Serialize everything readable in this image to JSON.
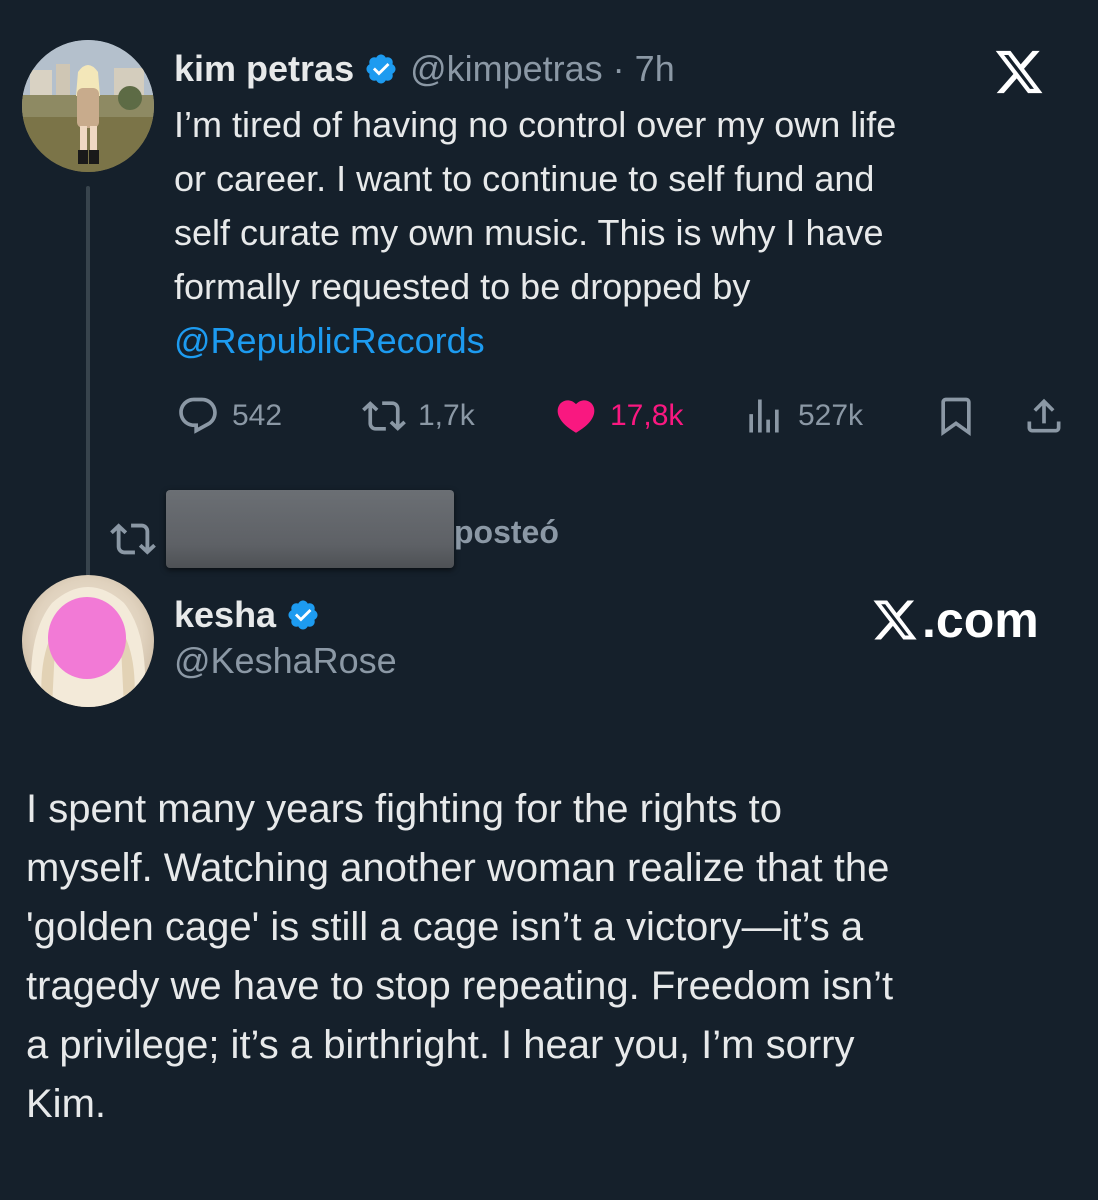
{
  "original_tweet": {
    "display_name": "kim petras",
    "meta": "@kimpetras · 7h",
    "text_lines": "I’m tired of having no control over my own life\nor career. I want to continue to self fund and\nself curate my own music. This is why I have\nformally requested to be dropped by",
    "mention": "@RepublicRecords",
    "actions": {
      "replies": "542",
      "reposts": "1,7k",
      "likes": "17,8k",
      "views": "527k"
    },
    "colors": {
      "like_active": "#f91880",
      "link": "#1d9bf0",
      "verified": "#1d9bf0"
    }
  },
  "repost_label": "posteó",
  "reply_tweet": {
    "display_name": "kesha",
    "handle": "@KeshaRose",
    "watermark": ".com",
    "text": "I spent many years fighting for the rights to\nmyself. Watching another woman realize that the\n'golden cage' is still a cage isn’t a victory—it’s a\ntragedy we have to stop repeating. Freedom isn’t\na privilege; it’s a birthright. I hear you, I’m sorry\nKim."
  }
}
